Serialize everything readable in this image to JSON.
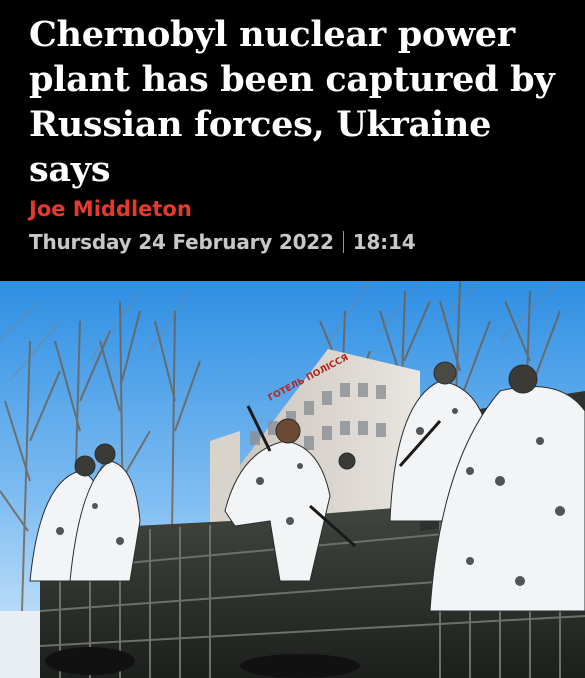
{
  "article": {
    "headline": "Chernobyl nuclear power plant has been captured by Russian forces, Ukraine says",
    "author": "Joe Middleton",
    "date": "Thursday 24 February 2022",
    "time": "18:14"
  },
  "photo": {
    "sign_text": "ГОТЕЛЬ ПОЛІССЯ"
  },
  "colors": {
    "background": "#000000",
    "headline": "#ffffff",
    "author": "#e5392c",
    "dateline": "#c8c8c8"
  }
}
